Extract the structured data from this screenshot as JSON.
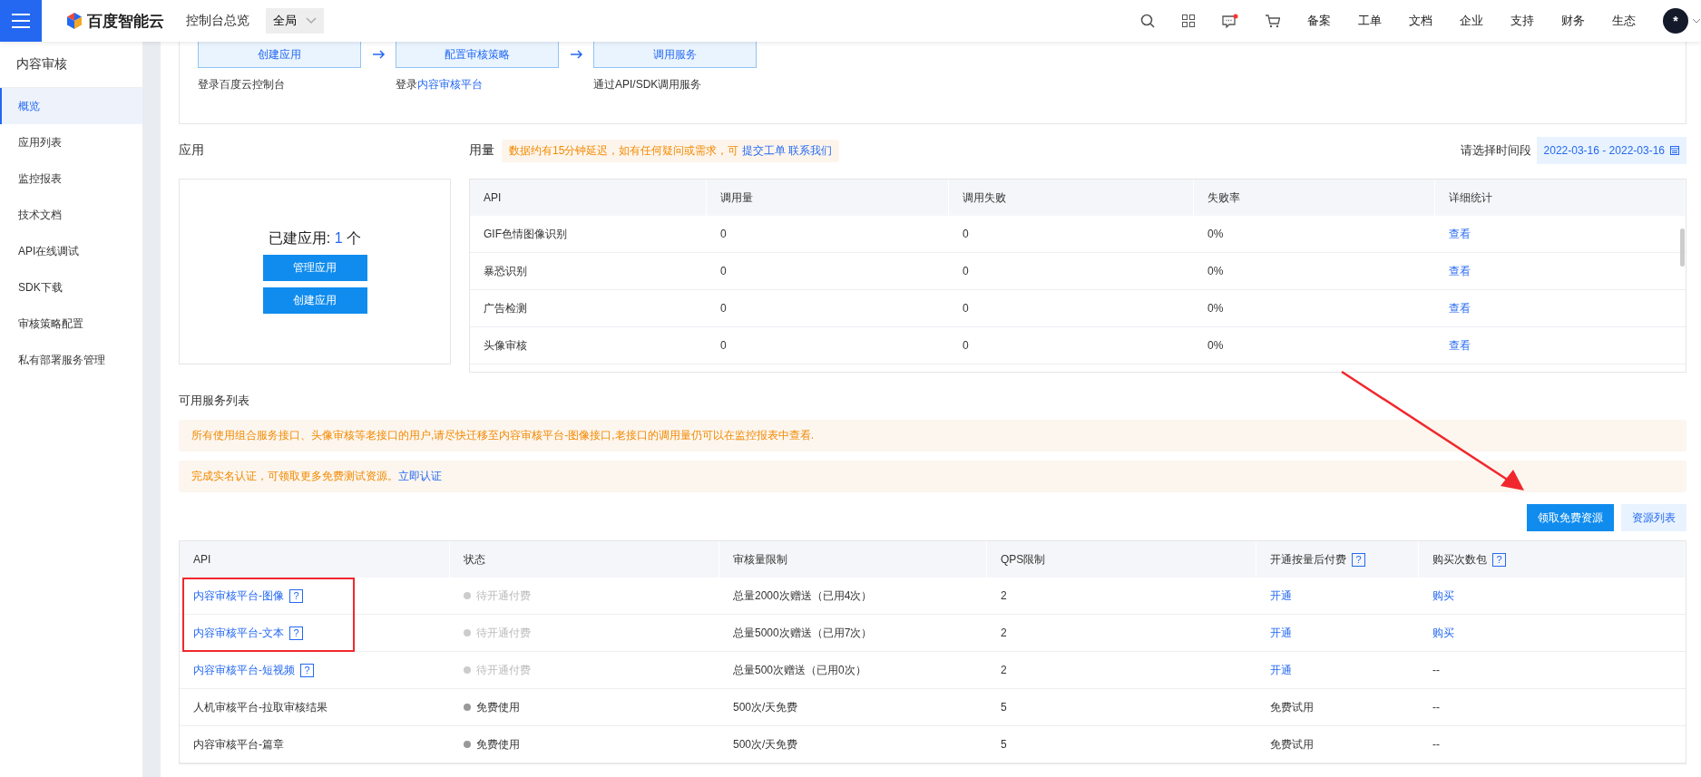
{
  "topbar": {
    "brand": "百度智能云",
    "title": "控制台总览",
    "region": "全局",
    "nav": [
      "备案",
      "工单",
      "文档",
      "企业",
      "支持",
      "财务",
      "生态"
    ],
    "avatar": "*",
    "has_notification": true
  },
  "sidebar": {
    "title": "内容审核",
    "items": [
      {
        "label": "概览",
        "selected": true
      },
      {
        "label": "应用列表",
        "selected": false
      },
      {
        "label": "监控报表",
        "selected": false
      },
      {
        "label": "技术文档",
        "selected": false
      },
      {
        "label": "API在线调试",
        "selected": false
      },
      {
        "label": "SDK下载",
        "selected": false
      },
      {
        "label": "审核策略配置",
        "selected": false
      },
      {
        "label": "私有部署服务管理",
        "selected": false
      }
    ]
  },
  "steps": [
    {
      "label": "创建应用",
      "caption": "登录百度云控制台"
    },
    {
      "label": "配置审核策略",
      "caption": "登录",
      "caption_link": "内容审核平台"
    },
    {
      "label": "调用服务",
      "caption": "通过API/SDK调用服务"
    }
  ],
  "apps": {
    "title": "应用",
    "count_label": "已建应用:",
    "count": "1",
    "unit": "个",
    "buttons": [
      "管理应用",
      "创建应用"
    ]
  },
  "usage": {
    "title": "用量",
    "notice": "数据约有15分钟延迟，如有任何疑问或需求，可",
    "notice_links": [
      "提交工单",
      "联系我们"
    ],
    "date_label": "请选择时间段",
    "date_range": "2022-03-16 - 2022-03-16",
    "columns": [
      "API",
      "调用量",
      "调用失败",
      "失败率",
      "详细统计"
    ],
    "rows": [
      [
        "GIF色情图像识别",
        "0",
        "0",
        "0%",
        "查看"
      ],
      [
        "暴恐识别",
        "0",
        "0",
        "0%",
        "查看"
      ],
      [
        "广告检测",
        "0",
        "0",
        "0%",
        "查看"
      ],
      [
        "头像审核",
        "0",
        "0",
        "0%",
        "查看"
      ]
    ]
  },
  "services": {
    "title": "可用服务列表",
    "notices": [
      {
        "text": "所有使用组合服务接口、头像审核等老接口的用户,请尽快迁移至内容审核平台-图像接口,老接口的调用量仍可以在监控报表中查看."
      },
      {
        "text": "完成实名认证，可领取更多免费测试资源。",
        "link": "立即认证"
      }
    ],
    "buttons": [
      {
        "label": "领取免费资源",
        "primary": true
      },
      {
        "label": "资源列表",
        "primary": false
      }
    ],
    "columns": [
      {
        "label": "API"
      },
      {
        "label": "状态"
      },
      {
        "label": "审核量限制"
      },
      {
        "label": "QPS限制"
      },
      {
        "label": "开通按量后付费",
        "help": "?"
      },
      {
        "label": "购买次数包",
        "help": "?"
      }
    ],
    "rows": [
      {
        "api": "内容审核平台-图像",
        "link": true,
        "help": "?",
        "highlighted": true,
        "status": "待开通付费",
        "enabled": false,
        "limit": "总量2000次赠送（已用4次）",
        "qps": "2",
        "postpay": "开通",
        "postpay_link": true,
        "pack": "购买",
        "pack_link": true
      },
      {
        "api": "内容审核平台-文本",
        "link": true,
        "help": "?",
        "highlighted": true,
        "status": "待开通付费",
        "enabled": false,
        "limit": "总量5000次赠送（已用7次）",
        "qps": "2",
        "postpay": "开通",
        "postpay_link": true,
        "pack": "购买",
        "pack_link": true
      },
      {
        "api": "内容审核平台-短视频",
        "link": true,
        "help": "?",
        "highlighted": false,
        "status": "待开通付费",
        "enabled": false,
        "limit": "总量500次赠送（已用0次）",
        "qps": "2",
        "postpay": "开通",
        "postpay_link": true,
        "pack": "--",
        "pack_link": false
      },
      {
        "api": "人机审核平台-拉取审核结果",
        "link": false,
        "highlighted": false,
        "status": "免费使用",
        "enabled": true,
        "limit": "500次/天免费",
        "qps": "5",
        "postpay": "免费试用",
        "postpay_link": false,
        "pack": "--",
        "pack_link": false
      },
      {
        "api": "内容审核平台-篇章",
        "link": false,
        "highlighted": false,
        "status": "免费使用",
        "enabled": true,
        "limit": "500次/天免费",
        "qps": "5",
        "postpay": "免费试用",
        "postpay_link": false,
        "pack": "--",
        "pack_link": false
      }
    ]
  }
}
